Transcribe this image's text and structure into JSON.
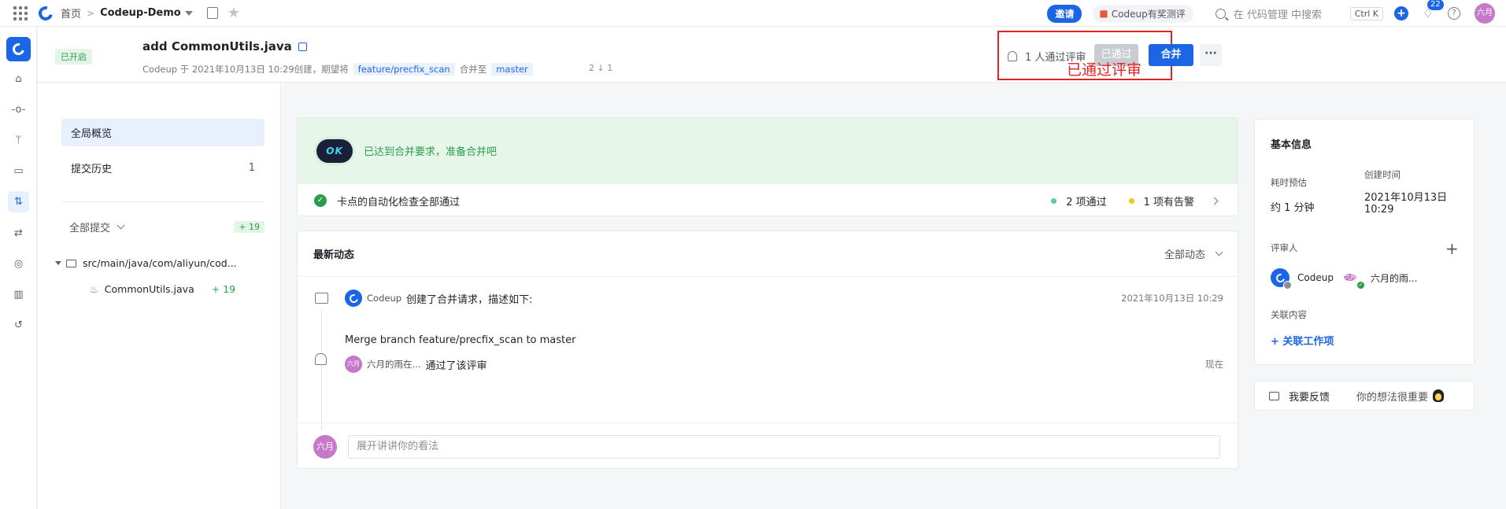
{
  "topbar": {
    "home": "首页",
    "project": "Codeup-Demo",
    "invite": "邀请",
    "survey": "Codeup有奖测评",
    "search_placeholder": "在 代码管理 中搜索",
    "shortcut": "Ctrl K",
    "notifications": "22",
    "avatar": "六月",
    "icons": [
      "apps-grid-icon",
      "codeup-logo-icon",
      "building-icon",
      "star-icon",
      "search-icon",
      "plus-icon",
      "bell-icon",
      "help-icon"
    ]
  },
  "header": {
    "status": "已开启",
    "title": "add CommonUtils.java",
    "meta_prefix": "Codeup 于 2021年10月13日 10:29创建，期望将",
    "source_branch": "feature/precfix_scan",
    "meta_mid": "合并至",
    "target_branch": "master",
    "counts": "2 ↓ 1",
    "reviewers_passed": "1 人通过评审",
    "passed_button": "已通过",
    "merge_button": "合并",
    "more_button": "···",
    "annotation": "已通过评审"
  },
  "leftnav": {
    "overview": "全局概览",
    "history": "提交历史",
    "history_count": "1",
    "all_commits": "全部提交",
    "additions": "+ 19",
    "dir": "src/main/java/com/aliyun/cod...",
    "file": "CommonUtils.java",
    "file_additions": "+ 19"
  },
  "status": {
    "ok": "OK",
    "ready": "已达到合并要求，准备合并吧",
    "checks": "卡点的自动化检查全部通过",
    "passed": "2 项通过",
    "warnings": "1 项有告警",
    "colors": {
      "pass": "#5cc9a7",
      "warn": "#f5c518"
    }
  },
  "activity": {
    "title": "最新动态",
    "filter": "全部动态",
    "event1_user": "Codeup",
    "event1_action": "创建了合并请求，描述如下:",
    "event1_time": "2021年10月13日 10:29",
    "event1_desc": "Merge branch feature/precfix_scan to master",
    "event2_avatar": "六月",
    "event2_user": "六月的雨在...",
    "event2_action": "通过了该评审",
    "event2_time": "现在",
    "comment_avatar": "六月",
    "comment_placeholder": "展开讲讲你的看法"
  },
  "info": {
    "title": "基本信息",
    "estimate_label": "耗时预估",
    "estimate_value": "约 1 分钟",
    "created_label": "创建时间",
    "created_value_line1": "2021年10月13日",
    "created_value_line2": "10:29",
    "reviewers_label": "评审人",
    "reviewer1": "Codeup",
    "reviewer2": "六月的雨...",
    "reviewer2_avatar": "六月",
    "related_label": "关联内容",
    "related_link": "+ 关联工作项"
  },
  "feedback": {
    "label": "我要反馈",
    "message": "你的想法很重要"
  }
}
